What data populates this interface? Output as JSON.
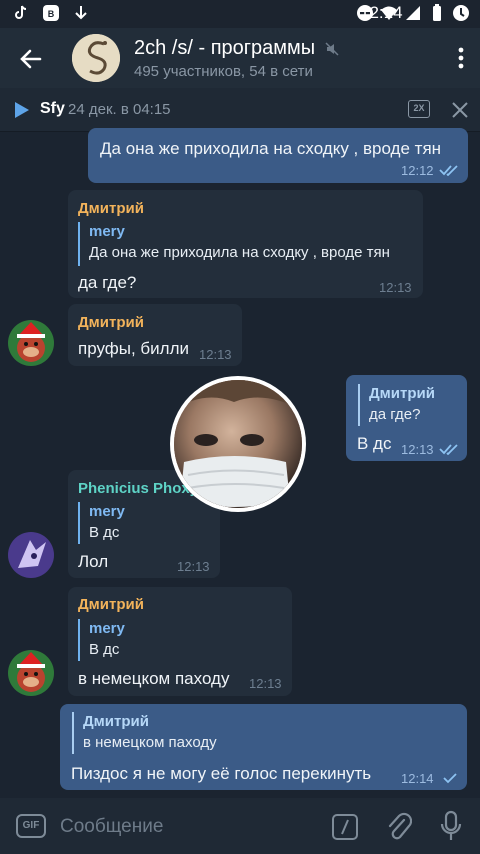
{
  "status_bar": {
    "time": "12:14"
  },
  "header": {
    "title": "2ch /s/ - программы",
    "subtitle": "495 участников, 54 в сети"
  },
  "player": {
    "name": "Sfy",
    "date": "24 дек. в 04:15",
    "speed": "2X"
  },
  "messages": [
    {
      "text": "Да она же приходила на сходку , вроде тян",
      "time": "12:12"
    },
    {
      "sender": "Дмитрий",
      "reply_name": "mery",
      "reply_text": "Да она же приходила на сходку , вроде тян",
      "text": "да где?",
      "time": "12:13"
    },
    {
      "sender": "Дмитрий",
      "text": "пруфы, билли",
      "time": "12:13"
    },
    {
      "reply_name": "Дмитрий",
      "reply_text": "да где?",
      "text": "В дс",
      "time": "12:13"
    },
    {
      "sender": "Phenicius Phoxy",
      "reply_name": "mery",
      "reply_text": "В дс",
      "text": "Лол",
      "time": "12:13"
    },
    {
      "sender": "Дмитрий",
      "reply_name": "mery",
      "reply_text": "В дс",
      "text": "в немецком паходу",
      "time": "12:13"
    },
    {
      "reply_name": "Дмитрий",
      "reply_text": "в немецком паходу",
      "text": "Пиздос я не могу её голос перекинуть",
      "time": "12:14"
    }
  ],
  "composer": {
    "gif_label": "GIF",
    "placeholder": "Сообщение"
  },
  "colors": {
    "background": "#1b2430",
    "incoming_bubble": "#232e3b",
    "outgoing_bubble": "#3b5b87",
    "header": "#222d39",
    "accent": "#6fb2ef"
  }
}
